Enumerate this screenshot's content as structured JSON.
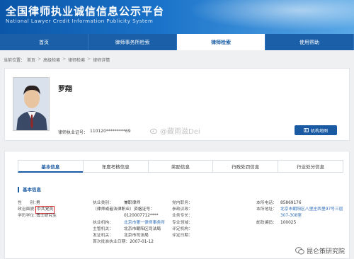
{
  "header": {
    "title": "全国律师执业诚信信息公示平台",
    "subtitle": "National Lawyer Credit Information Publicity System"
  },
  "nav": [
    "首页",
    "律师事务所检索",
    "律师检索",
    "使用帮助"
  ],
  "breadcrumb": {
    "prefix": "当前位置：",
    "items": [
      "首页",
      "高级检索",
      "律师检索",
      "律师详情"
    ],
    "separator": ">"
  },
  "profile": {
    "name": "罗翔",
    "license_label": "律师执业证号：",
    "license_value": "110120*********69",
    "map_button": "机构地图",
    "watermark": "@藏雨滋Dei"
  },
  "tabs": [
    "基本信息",
    "年度考核信息",
    "奖励信息",
    "行政处罚信息",
    "行业处分信息"
  ],
  "section_title": "基本信息",
  "fields": {
    "col1": [
      {
        "label": "性　　别：",
        "value": "男"
      },
      {
        "label": "政治面貌：",
        "value": "中共党员",
        "highlight": true
      },
      {
        "label": "学历学位：",
        "value": "博士研究生"
      }
    ],
    "col2": [
      {
        "label": "执业类别：",
        "value": "兼职律师"
      },
      {
        "label": "（律师或者法律职业）资格证号：",
        "value": ""
      },
      {
        "label": "",
        "value": "0120007712****"
      },
      {
        "label": "执业机构：",
        "value": "北京市第一律师事务所",
        "link": true
      },
      {
        "label": "主管机关：",
        "value": "北京市朝阳区司法局"
      },
      {
        "label": "发证机关：",
        "value": "北京市司法局"
      },
      {
        "label": "首次批准执业日期：",
        "value": "2007-01-12"
      }
    ],
    "col3": [
      {
        "label": "党内职务：",
        "value": ""
      },
      {
        "label": "参政议政：",
        "value": ""
      },
      {
        "label": "业务专长：",
        "value": ""
      },
      {
        "label": "专业领域：",
        "value": ""
      },
      {
        "label": "评定机构：",
        "value": ""
      },
      {
        "label": "评定日期：",
        "value": ""
      }
    ],
    "col4": [
      {
        "label": "本所电话：",
        "value": "85869176"
      },
      {
        "label": "本所地址：",
        "value": "北京市朝阳区八里庄西里97号三层307-308室",
        "link": true
      },
      {
        "label": "邮政编码：",
        "value": "100025"
      }
    ]
  },
  "footer_watermark": "昆仑策研究院"
}
